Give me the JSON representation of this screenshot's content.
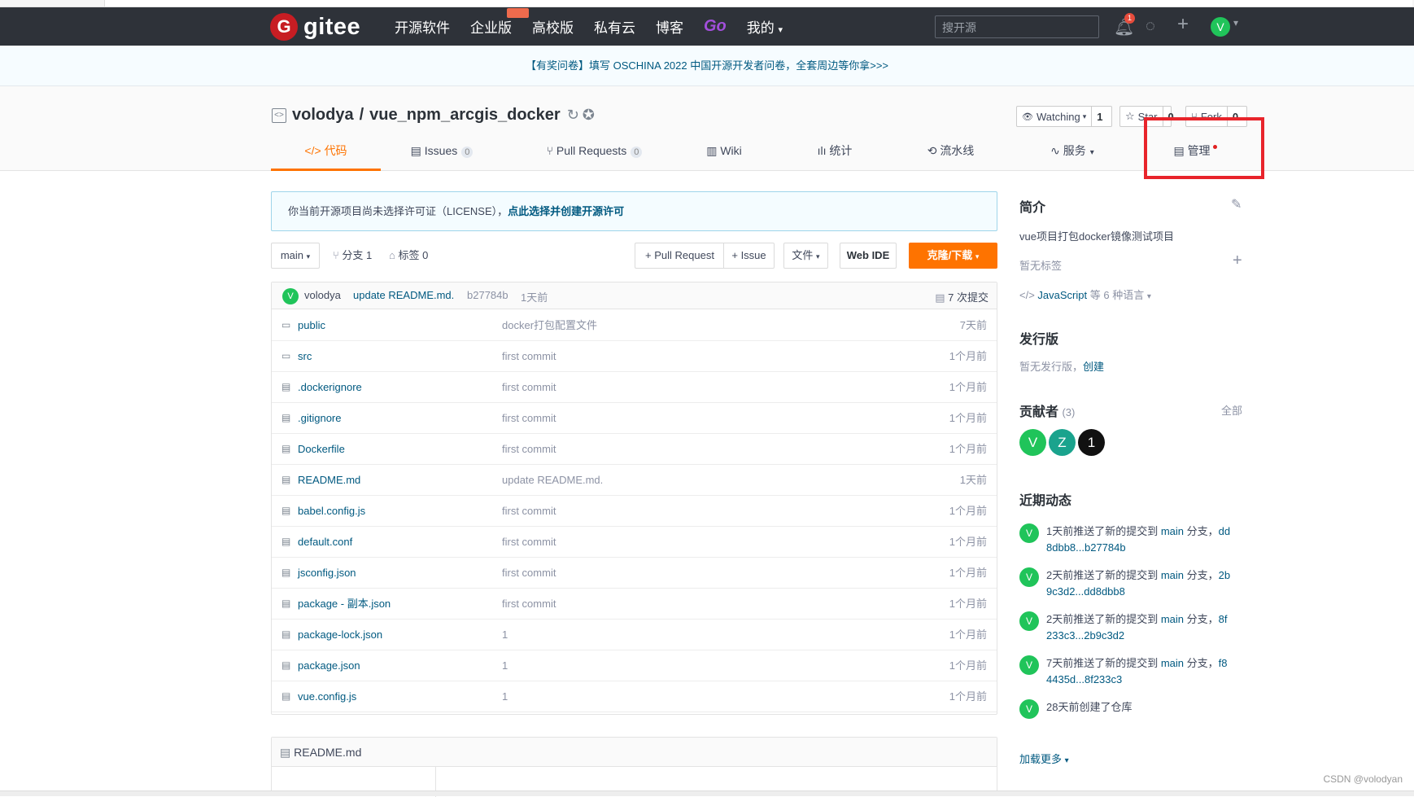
{
  "nav": {
    "logo_text": "gitee",
    "links": [
      "开源软件",
      "企业版",
      "高校版",
      "私有云",
      "博客",
      "Go",
      "我的"
    ],
    "search_placeholder": "搜开源",
    "notification_count": "1",
    "avatar_letter": "V"
  },
  "banner": {
    "text": "【有奖问卷】填写 OSCHINA 2022 中国开源开发者问卷，全套周边等你拿>>>"
  },
  "repo": {
    "owner": "volodya",
    "separator": "/",
    "name": "vue_npm_arcgis_docker",
    "watching_label": "Watching",
    "watching_count": "1",
    "star_label": "Star",
    "star_count": "0",
    "fork_label": "Fork",
    "fork_count": "0"
  },
  "tabs": [
    {
      "label": "代码",
      "icon": "code-icon"
    },
    {
      "label": "Issues",
      "badge": "0",
      "icon": "issues-icon"
    },
    {
      "label": "Pull Requests",
      "badge": "0",
      "icon": "pr-icon"
    },
    {
      "label": "Wiki",
      "icon": "wiki-icon"
    },
    {
      "label": "统计",
      "icon": "stats-icon"
    },
    {
      "label": "流水线",
      "icon": "pipeline-icon"
    },
    {
      "label": "服务",
      "icon": "service-icon"
    },
    {
      "label": "管理",
      "icon": "manage-icon"
    }
  ],
  "license_notice": {
    "text": "你当前开源项目尚未选择许可证（LICENSE），",
    "link": "点此选择并创建开源许可"
  },
  "toolbar": {
    "branch": "main",
    "branches_label": "分支 1",
    "tags_label": "标签 0",
    "pull_request": "+ Pull Request",
    "issue": "+ Issue",
    "files": "文件",
    "web_ide": "Web IDE",
    "clone": "克隆/下载"
  },
  "last_commit": {
    "avatar": "V",
    "author": "volodya",
    "message": "update README.md.",
    "sha": "b27784b",
    "time": "1天前",
    "count_label": "7 次提交"
  },
  "files": [
    {
      "name": "public",
      "type": "folder",
      "message": "docker打包配置文件",
      "time": "7天前"
    },
    {
      "name": "src",
      "type": "folder",
      "message": "first commit",
      "time": "1个月前"
    },
    {
      "name": ".dockerignore",
      "type": "file",
      "message": "first commit",
      "time": "1个月前"
    },
    {
      "name": ".gitignore",
      "type": "file",
      "message": "first commit",
      "time": "1个月前"
    },
    {
      "name": "Dockerfile",
      "type": "file",
      "message": "first commit",
      "time": "1个月前"
    },
    {
      "name": "README.md",
      "type": "file",
      "message": "update README.md.",
      "time": "1天前"
    },
    {
      "name": "babel.config.js",
      "type": "file",
      "message": "first commit",
      "time": "1个月前"
    },
    {
      "name": "default.conf",
      "type": "file",
      "message": "first commit",
      "time": "1个月前"
    },
    {
      "name": "jsconfig.json",
      "type": "file",
      "message": "first commit",
      "time": "1个月前"
    },
    {
      "name": "package - 副本.json",
      "type": "file",
      "message": "first commit",
      "time": "1个月前"
    },
    {
      "name": "package-lock.json",
      "type": "file",
      "message": "1",
      "time": "1个月前"
    },
    {
      "name": "package.json",
      "type": "file",
      "message": "1",
      "time": "1个月前"
    },
    {
      "name": "vue.config.js",
      "type": "file",
      "message": "1",
      "time": "1个月前"
    }
  ],
  "readme": {
    "title": "README.md"
  },
  "sidebar": {
    "intro_title": "简介",
    "intro_text": "vue项目打包docker镜像测试项目",
    "no_tags": "暂无标签",
    "language_link": "JavaScript",
    "language_more": "等 6 种语言",
    "releases_title": "发行版",
    "no_release": "暂无发行版，",
    "create_link": "创建",
    "contributors_title": "贡献者",
    "contributors_count": "(3)",
    "contributors_all": "全部",
    "contributors": [
      {
        "letter": "V",
        "color": "#20c45a"
      },
      {
        "letter": "Z",
        "color": "#1aa38d"
      },
      {
        "letter": "1",
        "color": "#111111"
      }
    ],
    "activity_title": "近期动态",
    "activities": [
      {
        "line1a": "1天前推送了新的提交到 ",
        "branch": "main",
        "line1b": " 分支，",
        "tail": "dd",
        "line2": "8dbb8...b27784b"
      },
      {
        "line1a": "2天前推送了新的提交到 ",
        "branch": "main",
        "line1b": " 分支，",
        "tail": "2b",
        "line2": "9c3d2...dd8dbb8"
      },
      {
        "line1a": "2天前推送了新的提交到 ",
        "branch": "main",
        "line1b": " 分支，",
        "tail": "8f",
        "line2": "233c3...2b9c3d2"
      },
      {
        "line1a": "7天前推送了新的提交到 ",
        "branch": "main",
        "line1b": " 分支，",
        "tail": "f8",
        "line2": "4435d...8f233c3"
      },
      {
        "line1a": "28天前创建了仓库",
        "branch": "",
        "line1b": "",
        "tail": "",
        "line2": ""
      }
    ],
    "load_more": "加载更多"
  },
  "watermark": "CSDN @volodyan"
}
